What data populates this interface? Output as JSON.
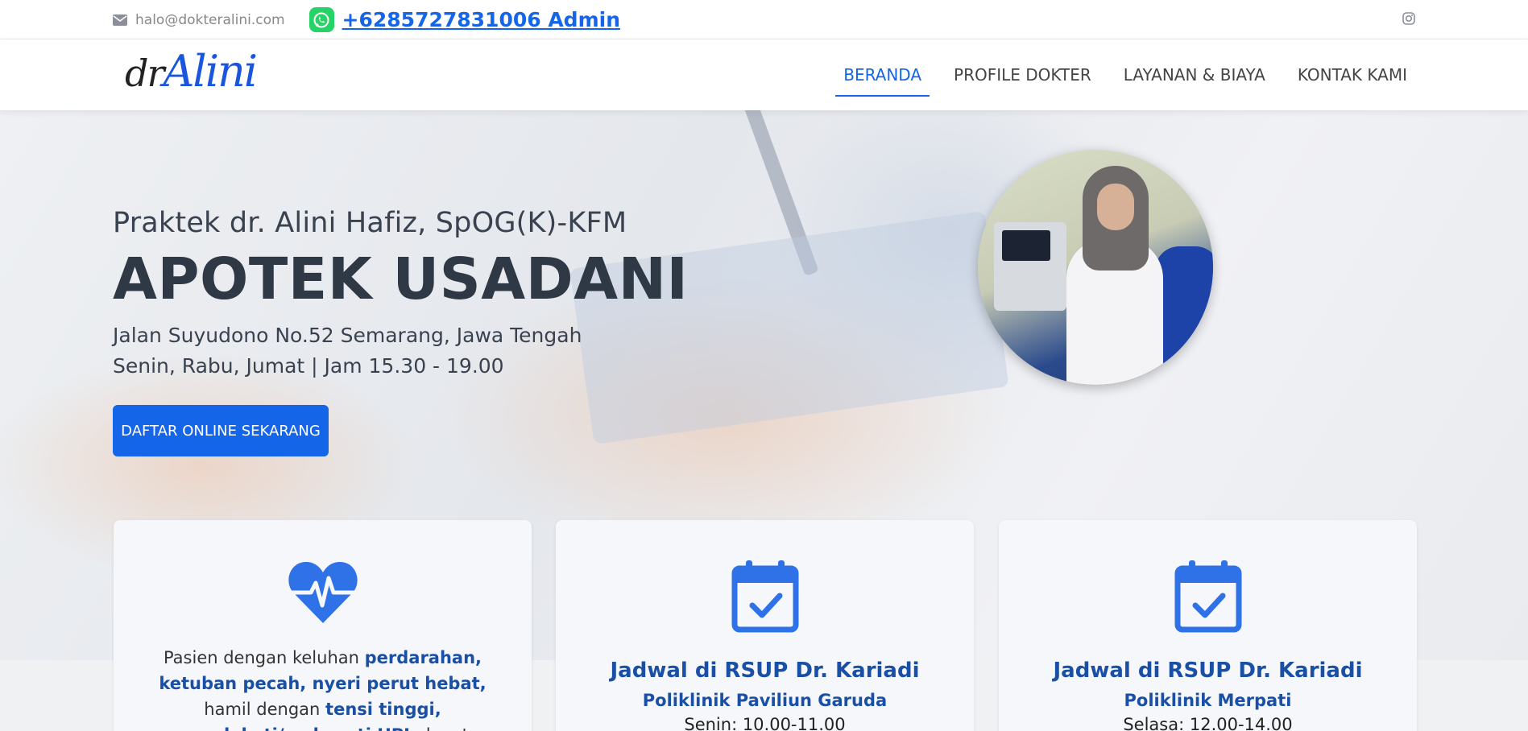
{
  "topbar": {
    "email": "halo@dokteralini.com",
    "whatsapp": "+6285727831006 Admin"
  },
  "header": {
    "logo_dr": "dr",
    "logo_name": "Alini",
    "nav": [
      "BERANDA",
      "PROFILE DOKTER",
      "LAYANAN & BIAYA",
      "KONTAK KAMI"
    ]
  },
  "hero": {
    "subtitle": "Praktek dr. Alini Hafiz, SpOG(K)-KFM",
    "title": "APOTEK USADANI",
    "address": "Jalan Suyudono No.52 Semarang, Jawa Tengah",
    "hours": "Senin, Rabu, Jumat | Jam 15.30 - 19.00",
    "cta": "DAFTAR ONLINE SEKARANG"
  },
  "cards": [
    {
      "desc_parts": [
        "Pasien dengan keluhan ",
        "perdarahan, ketuban pecah, nyeri perut hebat,",
        " hamil dengan ",
        "tensi tinggi, mendekati/melewati HPL",
        " dapat"
      ]
    },
    {
      "title": "Jadwal di RSUP Dr. Kariadi",
      "subtitle": "Poliklinik Paviliun Garuda",
      "time": "Senin: 10.00-11.00"
    },
    {
      "title": "Jadwal di RSUP Dr. Kariadi",
      "subtitle": "Poliklinik Merpati",
      "time": "Selasa: 12.00-14.00"
    }
  ],
  "colors": {
    "accent": "#1565e8",
    "heading_blue": "#1a4fa6",
    "whatsapp_green": "#25d366"
  }
}
